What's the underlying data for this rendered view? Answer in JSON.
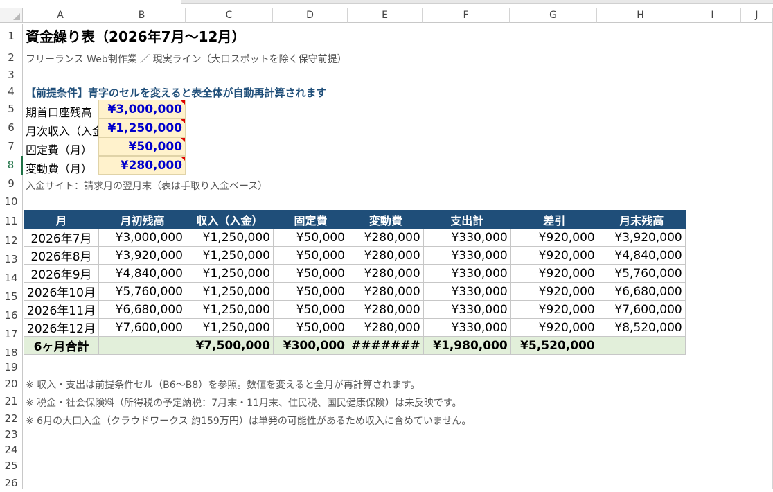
{
  "columns": [
    "A",
    "B",
    "C",
    "D",
    "E",
    "F",
    "G",
    "H",
    "I",
    "J"
  ],
  "rows": [
    "1",
    "2",
    "3",
    "4",
    "5",
    "6",
    "7",
    "8",
    "9",
    "10",
    "11",
    "12",
    "13",
    "14",
    "15",
    "16",
    "17",
    "18",
    "19",
    "20",
    "21",
    "22",
    "23",
    "24",
    "25",
    "26"
  ],
  "selected_row": "8",
  "sheet": {
    "title": "資金繰り表（2026年7月～12月）",
    "subtitle": "フリーランス Web制作業 ／ 現実ライン（大口スポットを除く保守前提）",
    "section_heading": "【前提条件】青字のセルを変えると表全体が自動再計算されます",
    "inputs": [
      {
        "label": "期首口座残高",
        "value": "¥3,000,000"
      },
      {
        "label": "月次収入（入金）",
        "value": "¥1,250,000"
      },
      {
        "label": "固定費（月）",
        "value": "¥50,000"
      },
      {
        "label": "変動費（月）",
        "value": "¥280,000"
      }
    ],
    "payment_note": "入金サイト：請求月の翌月末（表は手取り入金ベース）",
    "table": {
      "headers": [
        "月",
        "月初残高",
        "収入（入金）",
        "固定費",
        "変動費",
        "支出計",
        "差引",
        "月末残高"
      ],
      "rows": [
        [
          "2026年7月",
          "¥3,000,000",
          "¥1,250,000",
          "¥50,000",
          "¥280,000",
          "¥330,000",
          "¥920,000",
          "¥3,920,000"
        ],
        [
          "2026年8月",
          "¥3,920,000",
          "¥1,250,000",
          "¥50,000",
          "¥280,000",
          "¥330,000",
          "¥920,000",
          "¥4,840,000"
        ],
        [
          "2026年9月",
          "¥4,840,000",
          "¥1,250,000",
          "¥50,000",
          "¥280,000",
          "¥330,000",
          "¥920,000",
          "¥5,760,000"
        ],
        [
          "2026年10月",
          "¥5,760,000",
          "¥1,250,000",
          "¥50,000",
          "¥280,000",
          "¥330,000",
          "¥920,000",
          "¥6,680,000"
        ],
        [
          "2026年11月",
          "¥6,680,000",
          "¥1,250,000",
          "¥50,000",
          "¥280,000",
          "¥330,000",
          "¥920,000",
          "¥7,600,000"
        ],
        [
          "2026年12月",
          "¥7,600,000",
          "¥1,250,000",
          "¥50,000",
          "¥280,000",
          "¥330,000",
          "¥920,000",
          "¥8,520,000"
        ]
      ],
      "total": [
        "6ヶ月合計",
        "",
        "¥7,500,000",
        "¥300,000",
        "#######",
        "¥1,980,000",
        "¥5,520,000",
        ""
      ]
    },
    "notes": [
      "※ 収入・支出は前提条件セル（B6～B8）を参照。数値を変えると全月が再計算されます。",
      "※ 税金・社会保険料（所得税の予定納税：7月末・11月末、住民税、国民健康保険）は未反映です。",
      "※ 6月の大口入金（クラウドワークス 約159万円）は単発の可能性があるため収入に含めていません。"
    ]
  },
  "colors": {
    "header_fill": "#1f4e79",
    "input_fill": "#fff2cc",
    "input_text": "#0000cc",
    "total_fill": "#e2efda",
    "heading_text": "#1f4e79"
  }
}
